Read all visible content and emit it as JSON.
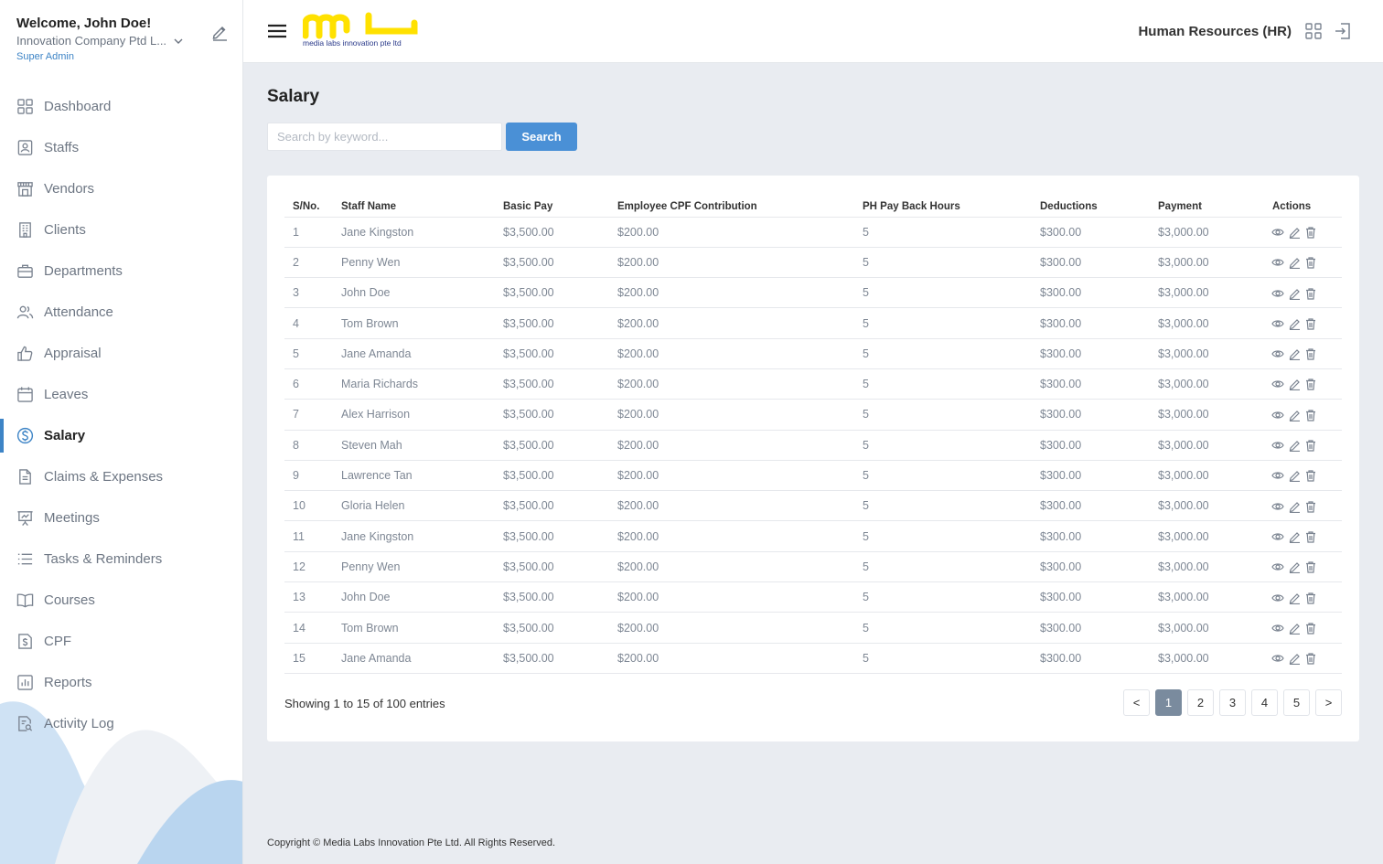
{
  "sidebar": {
    "welcome": "Welcome, John Doe!",
    "company": "Innovation Company Ptd L...",
    "role": "Super Admin",
    "items": [
      {
        "label": "Dashboard",
        "icon": "dashboard-icon"
      },
      {
        "label": "Staffs",
        "icon": "staff-badge-icon"
      },
      {
        "label": "Vendors",
        "icon": "store-icon"
      },
      {
        "label": "Clients",
        "icon": "building-icon"
      },
      {
        "label": "Departments",
        "icon": "briefcase-icon"
      },
      {
        "label": "Attendance",
        "icon": "users-icon"
      },
      {
        "label": "Appraisal",
        "icon": "thumbs-up-icon"
      },
      {
        "label": "Leaves",
        "icon": "calendar-icon"
      },
      {
        "label": "Salary",
        "icon": "dollar-circle-icon",
        "active": true
      },
      {
        "label": "Claims & Expenses",
        "icon": "document-icon"
      },
      {
        "label": "Meetings",
        "icon": "presentation-icon"
      },
      {
        "label": "Tasks & Reminders",
        "icon": "list-icon"
      },
      {
        "label": "Courses",
        "icon": "book-icon"
      },
      {
        "label": "CPF",
        "icon": "dollar-document-icon"
      },
      {
        "label": "Reports",
        "icon": "bar-chart-icon"
      },
      {
        "label": "Activity Log",
        "icon": "document-search-icon"
      }
    ]
  },
  "header": {
    "logo_text": "media labs innovation pte ltd",
    "department": "Human Resources (HR)"
  },
  "main": {
    "title": "Salary",
    "search": {
      "placeholder": "Search by keyword...",
      "value": "",
      "button": "Search"
    },
    "columns": [
      "S/No.",
      "Staff Name",
      "Basic Pay",
      "Employee CPF Contribution",
      "PH Pay Back Hours",
      "Deductions",
      "Payment",
      "Actions"
    ],
    "rows": [
      [
        "1",
        "Jane Kingston",
        "$3,500.00",
        "$200.00",
        "5",
        "$300.00",
        "$3,000.00"
      ],
      [
        "2",
        "Penny Wen",
        "$3,500.00",
        "$200.00",
        "5",
        "$300.00",
        "$3,000.00"
      ],
      [
        "3",
        "John Doe",
        "$3,500.00",
        "$200.00",
        "5",
        "$300.00",
        "$3,000.00"
      ],
      [
        "4",
        "Tom Brown",
        "$3,500.00",
        "$200.00",
        "5",
        "$300.00",
        "$3,000.00"
      ],
      [
        "5",
        "Jane Amanda",
        "$3,500.00",
        "$200.00",
        "5",
        "$300.00",
        "$3,000.00"
      ],
      [
        "6",
        "Maria Richards",
        "$3,500.00",
        "$200.00",
        "5",
        "$300.00",
        "$3,000.00"
      ],
      [
        "7",
        "Alex Harrison",
        "$3,500.00",
        "$200.00",
        "5",
        "$300.00",
        "$3,000.00"
      ],
      [
        "8",
        "Steven Mah",
        "$3,500.00",
        "$200.00",
        "5",
        "$300.00",
        "$3,000.00"
      ],
      [
        "9",
        "Lawrence Tan",
        "$3,500.00",
        "$200.00",
        "5",
        "$300.00",
        "$3,000.00"
      ],
      [
        "10",
        "Gloria Helen",
        "$3,500.00",
        "$200.00",
        "5",
        "$300.00",
        "$3,000.00"
      ],
      [
        "11",
        "Jane Kingston",
        "$3,500.00",
        "$200.00",
        "5",
        "$300.00",
        "$3,000.00"
      ],
      [
        "12",
        "Penny Wen",
        "$3,500.00",
        "$200.00",
        "5",
        "$300.00",
        "$3,000.00"
      ],
      [
        "13",
        "John Doe",
        "$3,500.00",
        "$200.00",
        "5",
        "$300.00",
        "$3,000.00"
      ],
      [
        "14",
        "Tom Brown",
        "$3,500.00",
        "$200.00",
        "5",
        "$300.00",
        "$3,000.00"
      ],
      [
        "15",
        "Jane Amanda",
        "$3,500.00",
        "$200.00",
        "5",
        "$300.00",
        "$3,000.00"
      ]
    ],
    "row_actions": [
      "view-icon",
      "edit-icon",
      "delete-icon"
    ],
    "showing": "Showing 1 to 15 of 100 entries",
    "pagination": {
      "prev": "<",
      "pages": [
        "1",
        "2",
        "3",
        "4",
        "5"
      ],
      "current": "1",
      "next": ">"
    }
  },
  "footer": {
    "copyright": "Copyright © Media Labs Innovation Pte Ltd. All Rights Reserved."
  },
  "colors": {
    "accent": "#4a90d6",
    "active_page": "#7a8b9e",
    "logo_yellow": "#ffe100",
    "background": "#e9ecf1"
  }
}
